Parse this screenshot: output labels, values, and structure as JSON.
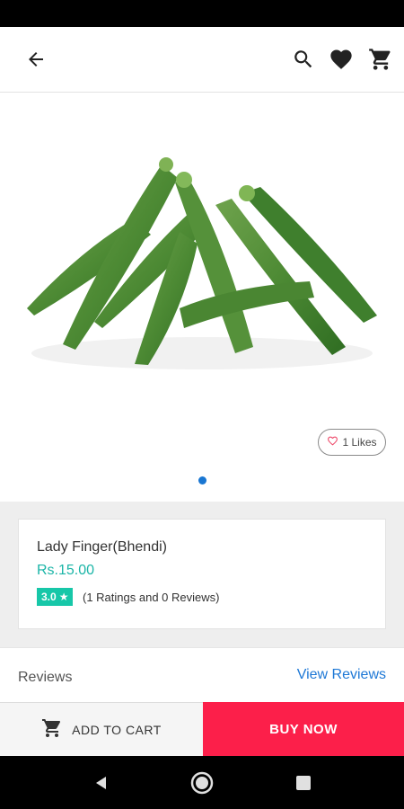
{
  "header": {
    "icons": [
      "arrow-back-icon",
      "search-icon",
      "heart-icon",
      "cart-icon"
    ]
  },
  "product": {
    "image": "okra-lady-finger-image",
    "likes_label": "1 Likes",
    "carousel_page": 1,
    "name": "Lady Finger(Bhendi)",
    "price": "Rs.15.00",
    "rating": "3.0",
    "rating_text": "(1 Ratings and 0 Reviews)"
  },
  "reviews": {
    "title": "Reviews",
    "link": "View Reviews"
  },
  "actions": {
    "add_to_cart": "ADD TO CART",
    "buy_now": "BUY NOW"
  },
  "colors": {
    "accent_teal": "#1bb5a7",
    "rating_badge": "#17c7a8",
    "link_blue": "#1e78d6",
    "buy_now_red": "#fc1f4a"
  },
  "system_nav": [
    "nav-back-icon",
    "nav-home-icon",
    "nav-recents-icon"
  ]
}
